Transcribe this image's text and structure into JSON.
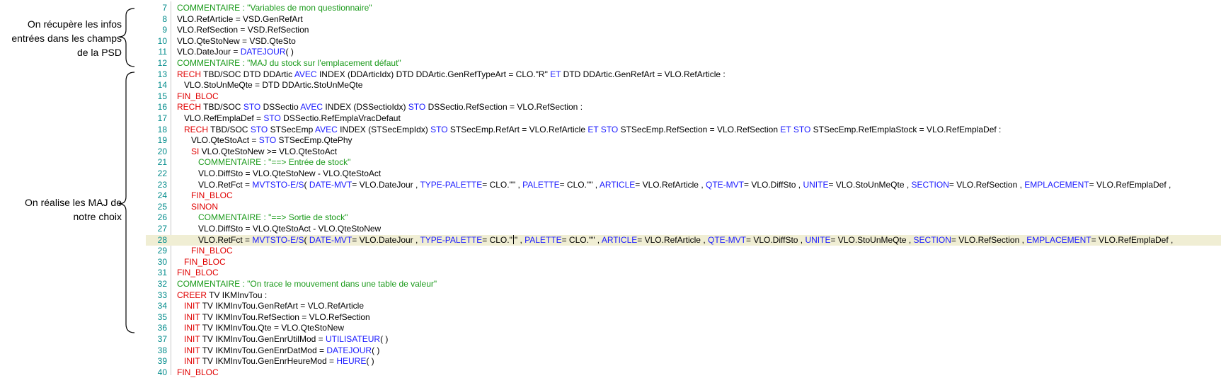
{
  "annotations": {
    "top": "On récupère les infos entrées dans les champs de la PSD",
    "bottom": "On réalise les MAJ de notre choix"
  },
  "editor": {
    "highlighted_line": 28,
    "lines": [
      {
        "n": "7",
        "indent": 0,
        "tokens": [
          [
            "c",
            "COMMENTAIRE : \"Variables de mon questionnaire\""
          ]
        ]
      },
      {
        "n": "8",
        "indent": 0,
        "tokens": [
          [
            "p",
            "VLO.RefArticle = VSD.GenRefArt"
          ]
        ]
      },
      {
        "n": "9",
        "indent": 0,
        "tokens": [
          [
            "p",
            "VLO.RefSection = VSD.RefSection"
          ]
        ]
      },
      {
        "n": "10",
        "indent": 0,
        "tokens": [
          [
            "p",
            "VLO.QteStoNew = VSD.QteSto"
          ]
        ]
      },
      {
        "n": "11",
        "indent": 0,
        "tokens": [
          [
            "p",
            "VLO.DateJour = "
          ],
          [
            "b",
            "DATEJOUR"
          ],
          [
            "p",
            "( )"
          ]
        ]
      },
      {
        "n": "12",
        "indent": 0,
        "tokens": [
          [
            "c",
            "COMMENTAIRE : \"MAJ du stock sur l'emplacement défaut\""
          ]
        ]
      },
      {
        "n": "13",
        "indent": 0,
        "tokens": [
          [
            "k",
            "RECH"
          ],
          [
            "p",
            " TBD/SOC DTD DDArtic "
          ],
          [
            "b",
            "AVEC"
          ],
          [
            "p",
            " INDEX (DDArticIdx) DTD DDArtic.GenRefTypeArt = CLO.\"R\" "
          ],
          [
            "b",
            "ET"
          ],
          [
            "p",
            " DTD DDArtic.GenRefArt = VLO.RefArticle :"
          ]
        ]
      },
      {
        "n": "14",
        "indent": 1,
        "tokens": [
          [
            "p",
            "VLO.StoUnMeQte = DTD DDArtic.StoUnMeQte"
          ]
        ]
      },
      {
        "n": "15",
        "indent": 0,
        "tokens": [
          [
            "k",
            "FIN_BLOC"
          ]
        ]
      },
      {
        "n": "16",
        "indent": 0,
        "tokens": [
          [
            "k",
            "RECH"
          ],
          [
            "p",
            " TBD/SOC "
          ],
          [
            "b",
            "STO"
          ],
          [
            "p",
            " DSSectio "
          ],
          [
            "b",
            "AVEC"
          ],
          [
            "p",
            " INDEX (DSSectioIdx) "
          ],
          [
            "b",
            "STO"
          ],
          [
            "p",
            " DSSectio.RefSection = VLO.RefSection :"
          ]
        ]
      },
      {
        "n": "17",
        "indent": 1,
        "tokens": [
          [
            "p",
            "VLO.RefEmplaDef = "
          ],
          [
            "b",
            "STO"
          ],
          [
            "p",
            " DSSectio.RefEmplaVracDefaut"
          ]
        ]
      },
      {
        "n": "18",
        "indent": 1,
        "tokens": [
          [
            "k",
            "RECH"
          ],
          [
            "p",
            " TBD/SOC "
          ],
          [
            "b",
            "STO"
          ],
          [
            "p",
            " STSecEmp "
          ],
          [
            "b",
            "AVEC"
          ],
          [
            "p",
            " INDEX (STSecEmpIdx) "
          ],
          [
            "b",
            "STO"
          ],
          [
            "p",
            " STSecEmp.RefArt = VLO.RefArticle "
          ],
          [
            "b",
            "ET"
          ],
          [
            "p",
            " "
          ],
          [
            "b",
            "STO"
          ],
          [
            "p",
            " STSecEmp.RefSection = VLO.RefSection "
          ],
          [
            "b",
            "ET"
          ],
          [
            "p",
            " "
          ],
          [
            "b",
            "STO"
          ],
          [
            "p",
            " STSecEmp.RefEmplaStock = VLO.RefEmplaDef :"
          ]
        ]
      },
      {
        "n": "19",
        "indent": 2,
        "tokens": [
          [
            "p",
            "VLO.QteStoAct = "
          ],
          [
            "b",
            "STO"
          ],
          [
            "p",
            " STSecEmp.QtePhy"
          ]
        ]
      },
      {
        "n": "20",
        "indent": 2,
        "tokens": [
          [
            "k",
            "SI"
          ],
          [
            "p",
            " VLO.QteStoNew >= VLO.QteStoAct"
          ]
        ]
      },
      {
        "n": "21",
        "indent": 3,
        "tokens": [
          [
            "c",
            "COMMENTAIRE : \"==> Entrée de stock\""
          ]
        ]
      },
      {
        "n": "22",
        "indent": 3,
        "tokens": [
          [
            "p",
            "VLO.DiffSto = VLO.QteStoNew - VLO.QteStoAct"
          ]
        ]
      },
      {
        "n": "23",
        "indent": 3,
        "tokens": [
          [
            "p",
            "VLO.RetFct = "
          ],
          [
            "b",
            "MVTSTO-E/S"
          ],
          [
            "p",
            "( "
          ],
          [
            "b",
            "DATE-MVT"
          ],
          [
            "p",
            "= VLO.DateJour , "
          ],
          [
            "b",
            "TYPE-PALETTE"
          ],
          [
            "p",
            "= CLO.\"\" , "
          ],
          [
            "b",
            "PALETTE"
          ],
          [
            "p",
            "= CLO.\"\" , "
          ],
          [
            "b",
            "ARTICLE"
          ],
          [
            "p",
            "= VLO.RefArticle , "
          ],
          [
            "b",
            "QTE-MVT"
          ],
          [
            "p",
            "= VLO.DiffSto , "
          ],
          [
            "b",
            "UNITE"
          ],
          [
            "p",
            "= VLO.StoUnMeQte , "
          ],
          [
            "b",
            "SECTION"
          ],
          [
            "p",
            "= VLO.RefSection , "
          ],
          [
            "b",
            "EMPLACEMENT"
          ],
          [
            "p",
            "= VLO.RefEmplaDef ,"
          ]
        ]
      },
      {
        "n": "24",
        "indent": 2,
        "tokens": [
          [
            "k",
            "FIN_BLOC"
          ]
        ]
      },
      {
        "n": "25",
        "indent": 2,
        "tokens": [
          [
            "k",
            "SINON"
          ]
        ]
      },
      {
        "n": "26",
        "indent": 3,
        "tokens": [
          [
            "c",
            "COMMENTAIRE : \"==> Sortie de stock\""
          ]
        ]
      },
      {
        "n": "27",
        "indent": 3,
        "tokens": [
          [
            "p",
            "VLO.DiffSto = VLO.QteStoAct - VLO.QteStoNew"
          ]
        ]
      },
      {
        "n": "28",
        "indent": 3,
        "tokens": [
          [
            "p",
            "VLO.RetFct = "
          ],
          [
            "b",
            "MVTSTO-E/S"
          ],
          [
            "p",
            "( "
          ],
          [
            "b",
            "DATE-MVT"
          ],
          [
            "p",
            "= VLO.DateJour , "
          ],
          [
            "b",
            "TYPE-PALETTE"
          ],
          [
            "p",
            "= CLO.\""
          ],
          [
            "caret",
            ""
          ],
          [
            "p",
            "\" , "
          ],
          [
            "b",
            "PALETTE"
          ],
          [
            "p",
            "= CLO.\"\" , "
          ],
          [
            "b",
            "ARTICLE"
          ],
          [
            "p",
            "= VLO.RefArticle , "
          ],
          [
            "b",
            "QTE-MVT"
          ],
          [
            "p",
            "= VLO.DiffSto , "
          ],
          [
            "b",
            "UNITE"
          ],
          [
            "p",
            "= VLO.StoUnMeQte , "
          ],
          [
            "b",
            "SECTION"
          ],
          [
            "p",
            "= VLO.RefSection , "
          ],
          [
            "b",
            "EMPLACEMENT"
          ],
          [
            "p",
            "= VLO.RefEmplaDef ,"
          ]
        ]
      },
      {
        "n": "29",
        "indent": 2,
        "tokens": [
          [
            "k",
            "FIN_BLOC"
          ]
        ]
      },
      {
        "n": "30",
        "indent": 1,
        "tokens": [
          [
            "k",
            "FIN_BLOC"
          ]
        ]
      },
      {
        "n": "31",
        "indent": 0,
        "tokens": [
          [
            "k",
            "FIN_BLOC"
          ]
        ]
      },
      {
        "n": "32",
        "indent": 0,
        "tokens": [
          [
            "c",
            "COMMENTAIRE : \"On trace le mouvement dans une table de valeur\""
          ]
        ]
      },
      {
        "n": "33",
        "indent": 0,
        "tokens": [
          [
            "k",
            "CREER"
          ],
          [
            "p",
            " TV IKMInvTou :"
          ]
        ]
      },
      {
        "n": "34",
        "indent": 1,
        "tokens": [
          [
            "k",
            "INIT"
          ],
          [
            "p",
            " TV IKMInvTou.GenRefArt = VLO.RefArticle"
          ]
        ]
      },
      {
        "n": "35",
        "indent": 1,
        "tokens": [
          [
            "k",
            "INIT"
          ],
          [
            "p",
            " TV IKMInvTou.RefSection = VLO.RefSection"
          ]
        ]
      },
      {
        "n": "36",
        "indent": 1,
        "tokens": [
          [
            "k",
            "INIT"
          ],
          [
            "p",
            " TV IKMInvTou.Qte = VLO.QteStoNew"
          ]
        ]
      },
      {
        "n": "37",
        "indent": 1,
        "tokens": [
          [
            "k",
            "INIT"
          ],
          [
            "p",
            " TV IKMInvTou.GenEnrUtilMod = "
          ],
          [
            "b",
            "UTILISATEUR"
          ],
          [
            "p",
            "( )"
          ]
        ]
      },
      {
        "n": "38",
        "indent": 1,
        "tokens": [
          [
            "k",
            "INIT"
          ],
          [
            "p",
            " TV IKMInvTou.GenEnrDatMod = "
          ],
          [
            "b",
            "DATEJOUR"
          ],
          [
            "p",
            "( )"
          ]
        ]
      },
      {
        "n": "39",
        "indent": 1,
        "tokens": [
          [
            "k",
            "INIT"
          ],
          [
            "p",
            " TV IKMInvTou.GenEnrHeureMod = "
          ],
          [
            "b",
            "HEURE"
          ],
          [
            "p",
            "( )"
          ]
        ]
      },
      {
        "n": "40",
        "indent": 0,
        "tokens": [
          [
            "k",
            "FIN_BLOC"
          ]
        ]
      }
    ]
  }
}
